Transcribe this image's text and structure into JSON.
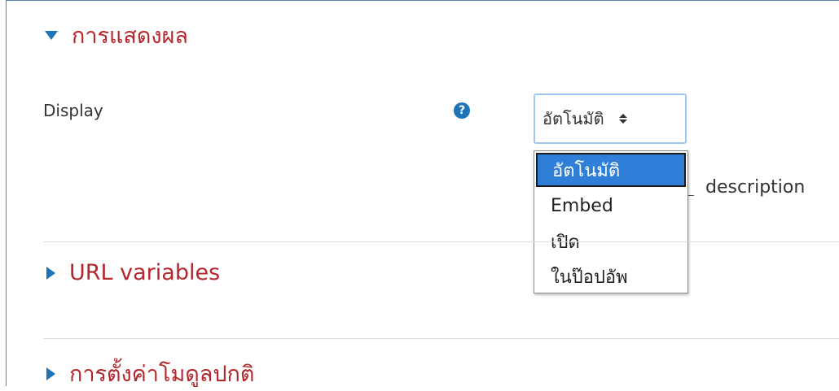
{
  "sections": {
    "appearance": {
      "label": "การแสดงผล"
    },
    "url_variables": {
      "label": "URL variables"
    },
    "common_module_settings": {
      "label": "การตั้งค่าโมดูลปกติ"
    }
  },
  "display_field": {
    "label": "Display",
    "help_icon_glyph": "?",
    "selected_value": "อัตโนมัติ",
    "options": [
      "อัตโนมัติ",
      "Embed",
      "เปิด",
      "ในป๊อปอัพ"
    ]
  },
  "description_text": "description",
  "colors": {
    "section_title": "#b3272d",
    "accent": "#1f73b7",
    "selected_option": "#2f7fd9"
  },
  "icons": {
    "expanded": "triangle-down-icon",
    "collapsed": "triangle-right-icon",
    "help": "question-circle-icon",
    "select": "sort-arrows-icon"
  }
}
